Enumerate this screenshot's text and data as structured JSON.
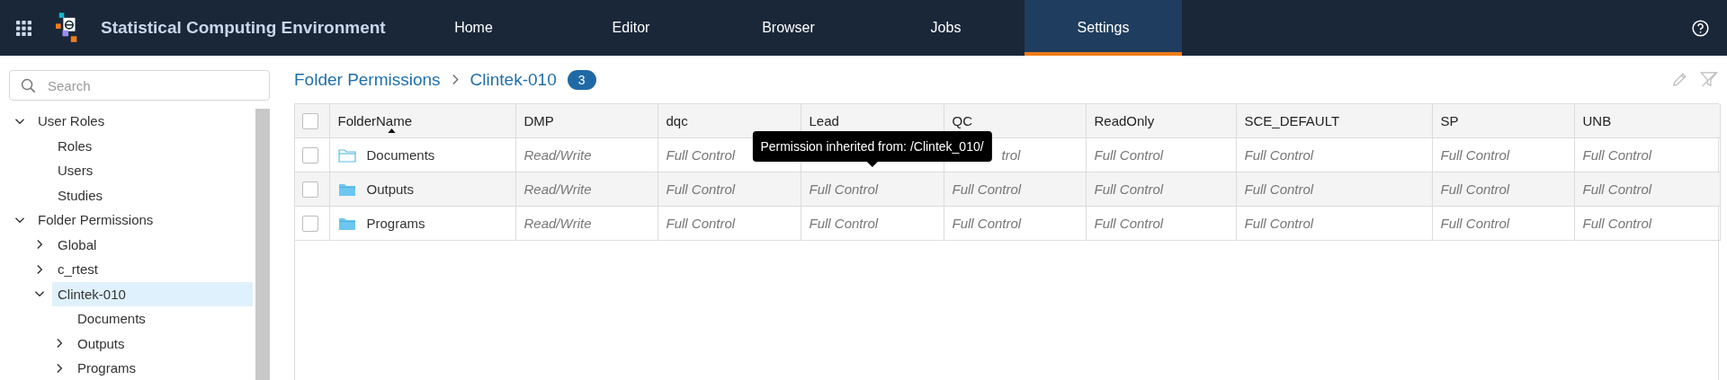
{
  "app": {
    "title": "Statistical Computing Environment"
  },
  "nav": [
    {
      "label": "Home",
      "selected": false
    },
    {
      "label": "Editor",
      "selected": false
    },
    {
      "label": "Browser",
      "selected": false
    },
    {
      "label": "Jobs",
      "selected": false
    },
    {
      "label": "Settings",
      "selected": true
    }
  ],
  "sidebar": {
    "search": {
      "placeholder": "Search"
    },
    "tree": [
      {
        "label": "User Roles",
        "kind": "branch",
        "expanded": true,
        "selected": false,
        "children": [
          {
            "label": "Roles",
            "kind": "leaf",
            "selected": false
          },
          {
            "label": "Users",
            "kind": "leaf",
            "selected": false
          },
          {
            "label": "Studies",
            "kind": "leaf",
            "selected": false
          }
        ]
      },
      {
        "label": "Folder Permissions",
        "kind": "branch",
        "expanded": true,
        "selected": false,
        "children": [
          {
            "label": "Global",
            "kind": "branch",
            "expanded": false,
            "selected": false
          },
          {
            "label": "c_rtest",
            "kind": "branch",
            "expanded": false,
            "selected": false
          },
          {
            "label": "Clintek-010",
            "kind": "branch",
            "expanded": true,
            "selected": true,
            "children": [
              {
                "label": "Documents",
                "kind": "leaf",
                "selected": false
              },
              {
                "label": "Outputs",
                "kind": "branch",
                "expanded": false,
                "selected": false
              },
              {
                "label": "Programs",
                "kind": "branch",
                "expanded": false,
                "selected": false
              }
            ]
          }
        ]
      }
    ]
  },
  "breadcrumb": [
    {
      "label": "Folder Permissions"
    },
    {
      "label": "Clintek-010"
    }
  ],
  "count_badge": "3",
  "table": {
    "header_checked": false,
    "columns": [
      {
        "label": "FolderName",
        "sorted": true
      },
      {
        "label": "DMP",
        "sorted": false
      },
      {
        "label": "dqc",
        "sorted": false
      },
      {
        "label": "Lead",
        "sorted": false
      },
      {
        "label": "QC",
        "sorted": false
      },
      {
        "label": "ReadOnly",
        "sorted": false
      },
      {
        "label": "SCE_DEFAULT",
        "sorted": false
      },
      {
        "label": "SP",
        "sorted": false
      },
      {
        "label": "UNB",
        "sorted": false
      }
    ],
    "rows": [
      {
        "checked": false,
        "kind": "outline",
        "cells": [
          "Documents",
          "Read/Write",
          "Full Control",
          {
            "tooltip": "Permission inherited from: /Clintek_010/"
          },
          {
            "text": "trol"
          },
          "Full Control",
          "Full Control",
          "Full Control",
          "Full Control"
        ]
      },
      {
        "checked": false,
        "kind": "filled",
        "cells": [
          "Outputs",
          "Read/Write",
          "Full Control",
          "Full Control",
          "Full Control",
          "Full Control",
          "Full Control",
          "Full Control",
          "Full Control"
        ]
      },
      {
        "checked": false,
        "kind": "filled",
        "cells": [
          "Programs",
          "Read/Write",
          "Full Control",
          "Full Control",
          "Full Control",
          "Full Control",
          "Full Control",
          "Full Control",
          "Full Control"
        ]
      }
    ]
  }
}
